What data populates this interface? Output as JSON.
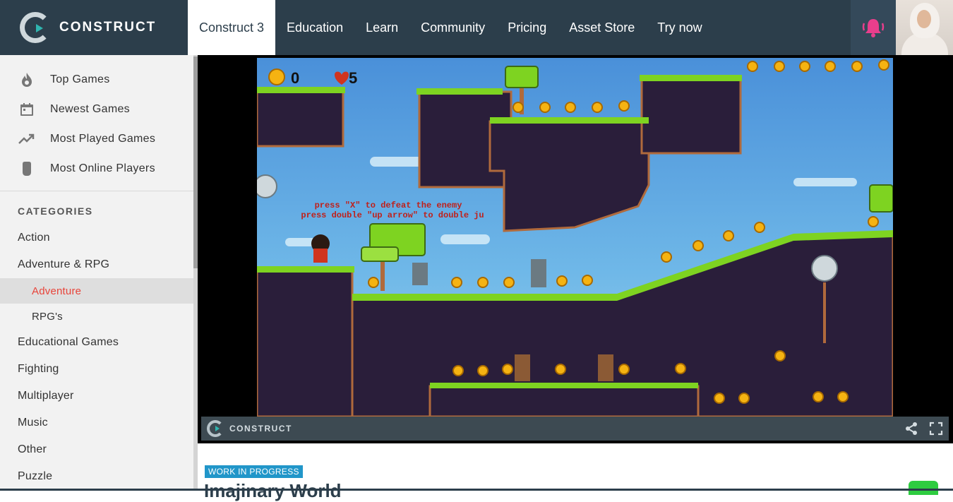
{
  "header": {
    "logo_text": "CONSTRUCT",
    "nav": [
      {
        "label": "Construct 3",
        "active": true
      },
      {
        "label": "Education"
      },
      {
        "label": "Learn"
      },
      {
        "label": "Community"
      },
      {
        "label": "Pricing"
      },
      {
        "label": "Asset Store"
      },
      {
        "label": "Try now"
      }
    ],
    "bell_icon": "bell-ringing-icon",
    "bell_color": "#e83e8c"
  },
  "sidebar": {
    "top_items": [
      {
        "label": "Top Games",
        "icon": "flame-icon"
      },
      {
        "label": "Newest Games",
        "icon": "calendar-icon"
      },
      {
        "label": "Most Played Games",
        "icon": "trending-up-icon"
      },
      {
        "label": "Most Online Players",
        "icon": "player-icon"
      }
    ],
    "categories_heading": "CATEGORIES",
    "categories": [
      {
        "label": "Action"
      },
      {
        "label": "Adventure & RPG"
      },
      {
        "label": "Adventure",
        "sub": true,
        "selected": true
      },
      {
        "label": "RPG's",
        "sub": true
      },
      {
        "label": "Educational Games"
      },
      {
        "label": "Fighting"
      },
      {
        "label": "Multiplayer"
      },
      {
        "label": "Music"
      },
      {
        "label": "Other"
      },
      {
        "label": "Puzzle"
      }
    ],
    "selected_color": "#e8443a"
  },
  "game": {
    "hud_coins": "0",
    "hud_lives": "5",
    "hint_line1": "press \"X\" to defeat the enemy",
    "hint_line2": "press double \"up arrow\" to double ju",
    "bar_logo_text": "CONSTRUCT",
    "share_icon": "share-icon",
    "fullscreen_icon": "fullscreen-icon"
  },
  "listing": {
    "badge": "WORK IN PROGRESS",
    "badge_color": "#2196c9",
    "title": "Imajinary World"
  }
}
